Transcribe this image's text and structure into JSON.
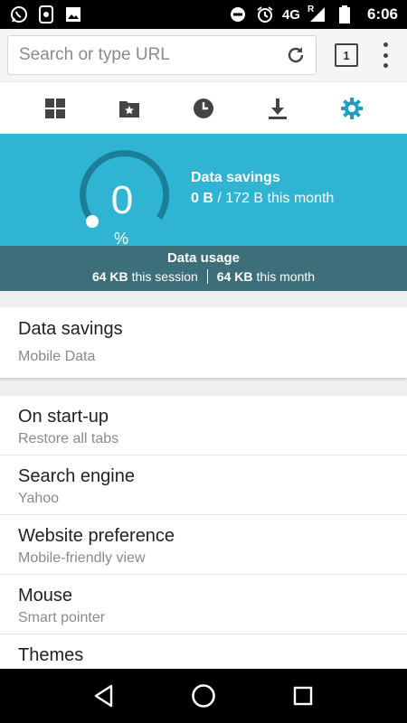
{
  "status_bar": {
    "network": "4G",
    "roaming": "R",
    "time": "6:06"
  },
  "url_bar": {
    "placeholder": "Search or type URL",
    "tab_count": "1"
  },
  "toolbar_tabs": [
    {
      "icon": "grid-icon"
    },
    {
      "icon": "bookmark-folder-icon"
    },
    {
      "icon": "history-clock-icon"
    },
    {
      "icon": "download-icon"
    },
    {
      "icon": "gear-icon",
      "active": true
    }
  ],
  "banner": {
    "gauge_value": "0",
    "gauge_unit": "%",
    "savings_title": "Data savings",
    "savings_amount": "0 B",
    "savings_total": "/ 172 B this month",
    "usage_title": "Data usage",
    "session_amount": "64 KB",
    "session_label": "this session",
    "month_amount": "64 KB",
    "month_label": "this month"
  },
  "settings_primary": [
    {
      "title": "Data savings",
      "subtitle": "Mobile Data"
    }
  ],
  "settings": [
    {
      "title": "On start-up",
      "subtitle": "Restore all tabs"
    },
    {
      "title": "Search engine",
      "subtitle": "Yahoo"
    },
    {
      "title": "Website preference",
      "subtitle": "Mobile-friendly view"
    },
    {
      "title": "Mouse",
      "subtitle": "Smart pointer"
    },
    {
      "title": "Themes",
      "subtitle": ""
    }
  ],
  "colors": {
    "accent": "#2fb4d3",
    "usage_strip": "#3d6f7b",
    "active_tab": "#1e9fc2"
  }
}
